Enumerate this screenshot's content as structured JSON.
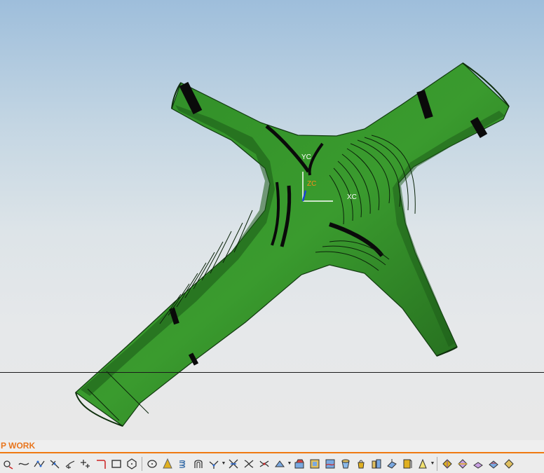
{
  "viewport": {
    "wcs": {
      "yc_label": "YC",
      "zc_label": "ZC",
      "xc_label": "XC"
    },
    "model_color": "#2b7a23",
    "background_top": "#9ebedb",
    "background_bottom": "#e8e8e8"
  },
  "status": {
    "work_label": "P WORK",
    "accent_color": "#f07a12"
  },
  "toolbar": {
    "icons": [
      "point-icon",
      "spline-icon",
      "curve-network-icon",
      "poly-curve-icon",
      "point-set-icon",
      "plus-point-icon",
      "fillet-corner-icon",
      "rectangle-icon",
      "polygon-icon",
      "ellipse-icon",
      "blend-solid-icon",
      "helix-icon",
      "arc-curve-icon",
      "offset-curve-icon",
      "trim-curve-icon",
      "extend-curve-icon",
      "bridge-curve-icon",
      "curve-edit-icon",
      "surface-patch-icon",
      "surface-face-icon",
      "surface-blend-icon",
      "cylinder-icon",
      "bucket-icon",
      "extruded-box-icon",
      "planar-face-icon",
      "flag-icon",
      "surface-analysis-icon",
      "sweep-icon",
      "through-curves-icon",
      "face-edit-icon",
      "offset-face-icon",
      "snap-icon"
    ]
  }
}
